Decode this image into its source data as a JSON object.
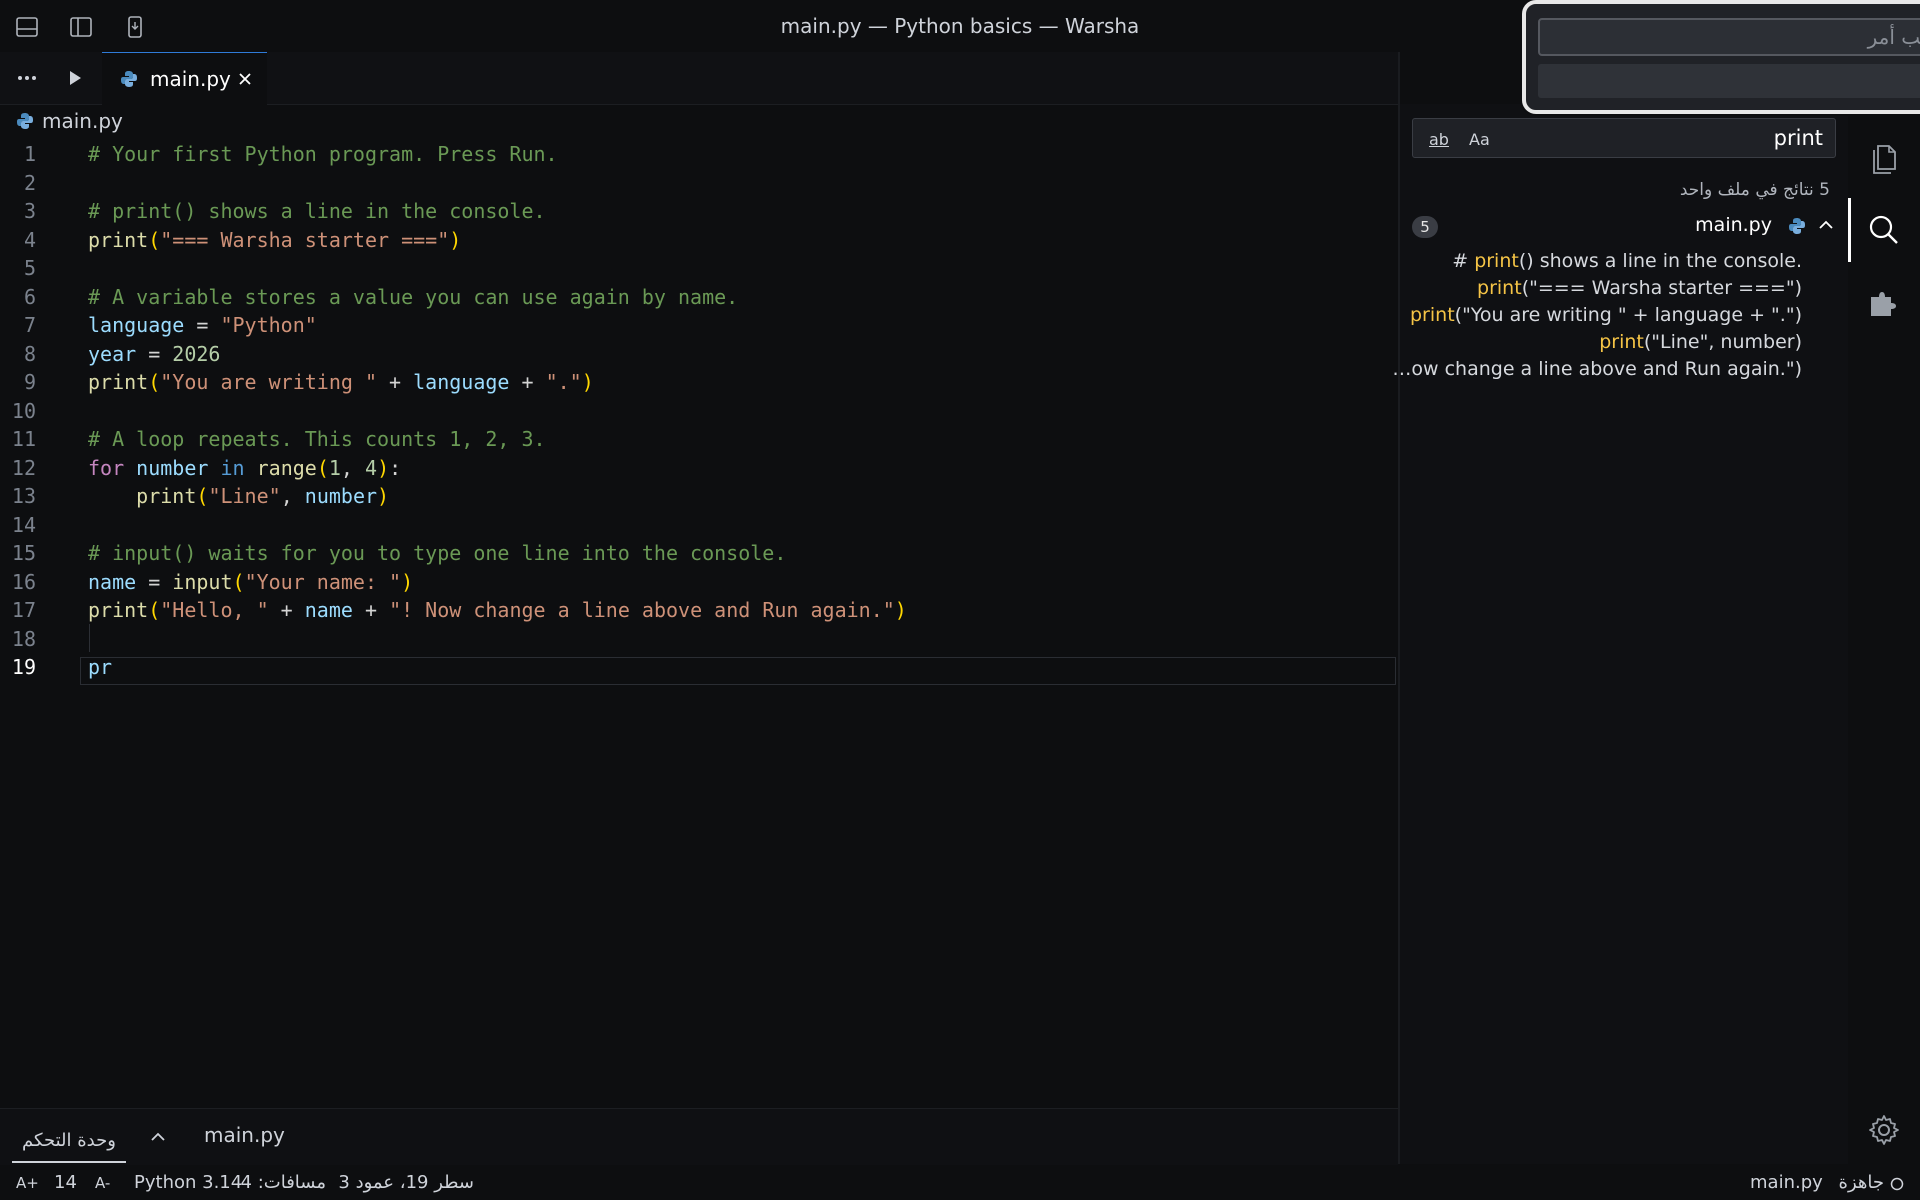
{
  "window": {
    "title": "main.py — Python basics — Warsha"
  },
  "tabs": [
    {
      "label": "main.py"
    }
  ],
  "breadcrumb": {
    "file": "main.py"
  },
  "editor": {
    "current_line": 19,
    "lines": [
      {
        "n": "1",
        "tokens": [
          {
            "t": "# Your first Python program. Press Run.",
            "c": "cmt"
          }
        ]
      },
      {
        "n": "2",
        "tokens": []
      },
      {
        "n": "3",
        "tokens": [
          {
            "t": "# print() shows a line in the console.",
            "c": "cmt"
          }
        ]
      },
      {
        "n": "4",
        "tokens": [
          {
            "t": "print",
            "c": "fn"
          },
          {
            "t": "(",
            "c": "par"
          },
          {
            "t": "\"=== Warsha starter ===\"",
            "c": "str"
          },
          {
            "t": ")",
            "c": "par"
          }
        ]
      },
      {
        "n": "5",
        "tokens": []
      },
      {
        "n": "6",
        "tokens": [
          {
            "t": "# A variable stores a value you can use again by name.",
            "c": "cmt"
          }
        ]
      },
      {
        "n": "7",
        "tokens": [
          {
            "t": "language",
            "c": "var"
          },
          {
            "t": " = ",
            "c": "pun"
          },
          {
            "t": "\"Python\"",
            "c": "str"
          }
        ]
      },
      {
        "n": "8",
        "tokens": [
          {
            "t": "year",
            "c": "var"
          },
          {
            "t": " = ",
            "c": "pun"
          },
          {
            "t": "2026",
            "c": "num"
          }
        ]
      },
      {
        "n": "9",
        "tokens": [
          {
            "t": "print",
            "c": "fn"
          },
          {
            "t": "(",
            "c": "par"
          },
          {
            "t": "\"You are writing \"",
            "c": "str"
          },
          {
            "t": " + ",
            "c": "pun"
          },
          {
            "t": "language",
            "c": "var"
          },
          {
            "t": " + ",
            "c": "pun"
          },
          {
            "t": "\".\"",
            "c": "str"
          },
          {
            "t": ")",
            "c": "par"
          }
        ]
      },
      {
        "n": "10",
        "tokens": []
      },
      {
        "n": "11",
        "tokens": [
          {
            "t": "# A loop repeats. This counts 1, 2, 3.",
            "c": "cmt"
          }
        ]
      },
      {
        "n": "12",
        "tokens": [
          {
            "t": "for",
            "c": "kw"
          },
          {
            "t": " ",
            "c": "pun"
          },
          {
            "t": "number",
            "c": "var"
          },
          {
            "t": " ",
            "c": "pun"
          },
          {
            "t": "in",
            "c": "kwb"
          },
          {
            "t": " ",
            "c": "pun"
          },
          {
            "t": "range",
            "c": "fn"
          },
          {
            "t": "(",
            "c": "par"
          },
          {
            "t": "1",
            "c": "num"
          },
          {
            "t": ", ",
            "c": "pun"
          },
          {
            "t": "4",
            "c": "num"
          },
          {
            "t": ")",
            "c": "par"
          },
          {
            "t": ":",
            "c": "pun"
          }
        ]
      },
      {
        "n": "13",
        "tokens": [
          {
            "t": "    ",
            "c": "pun"
          },
          {
            "t": "print",
            "c": "fn"
          },
          {
            "t": "(",
            "c": "par"
          },
          {
            "t": "\"Line\"",
            "c": "str"
          },
          {
            "t": ", ",
            "c": "pun"
          },
          {
            "t": "number",
            "c": "var"
          },
          {
            "t": ")",
            "c": "par"
          }
        ]
      },
      {
        "n": "14",
        "tokens": []
      },
      {
        "n": "15",
        "tokens": [
          {
            "t": "# input() waits for you to type one line into the console.",
            "c": "cmt"
          }
        ]
      },
      {
        "n": "16",
        "tokens": [
          {
            "t": "name",
            "c": "var"
          },
          {
            "t": " = ",
            "c": "pun"
          },
          {
            "t": "input",
            "c": "fn"
          },
          {
            "t": "(",
            "c": "par"
          },
          {
            "t": "\"Your name: \"",
            "c": "str"
          },
          {
            "t": ")",
            "c": "par"
          }
        ]
      },
      {
        "n": "17",
        "tokens": [
          {
            "t": "print",
            "c": "fn"
          },
          {
            "t": "(",
            "c": "par"
          },
          {
            "t": "\"Hello, \"",
            "c": "str"
          },
          {
            "t": " + ",
            "c": "pun"
          },
          {
            "t": "name",
            "c": "var"
          },
          {
            "t": " + ",
            "c": "pun"
          },
          {
            "t": "\"! Now change a line above and Run again.\"",
            "c": "str"
          },
          {
            "t": ")",
            "c": "par"
          }
        ]
      },
      {
        "n": "18",
        "tokens": []
      },
      {
        "n": "19",
        "tokens": [
          {
            "t": "pr",
            "c": "var"
          }
        ]
      }
    ]
  },
  "search": {
    "query": "print",
    "opt_whole_word": "ab",
    "opt_match_case": "Aa",
    "summary": "5 نتائج في ملف واحد",
    "file": {
      "name": "main.py",
      "count": "5"
    },
    "results": [
      {
        "pre": "# ",
        "hl": "print",
        "post": "() shows a line in the console."
      },
      {
        "pre": "",
        "hl": "print",
        "post": "(\"=== Warsha starter ===\")"
      },
      {
        "pre": "",
        "hl": "print",
        "post": "(\"You are writing \" + language + \".\")"
      },
      {
        "pre": "",
        "hl": "print",
        "post": "(\"Line\", number)"
      },
      {
        "pre": "",
        "hl": "",
        "post": "…ow change a line above and Run again.\")"
      }
    ]
  },
  "command_palette": {
    "placeholder": "اكتب أمر"
  },
  "panel": {
    "console_tab": "وحدة التحكم",
    "file": "main.py"
  },
  "status": {
    "ready": "جاهزة",
    "file": "main.py",
    "position": "سطر 19، عمود 3",
    "spaces": "مسافات: 4",
    "language": "Python 3.14",
    "font_decrease": "A-",
    "font_size": "14",
    "font_increase": "A+"
  },
  "colors": {
    "accent": "#2f7bd8",
    "match_highlight": "#f5c446",
    "background": "#0d0e10"
  }
}
